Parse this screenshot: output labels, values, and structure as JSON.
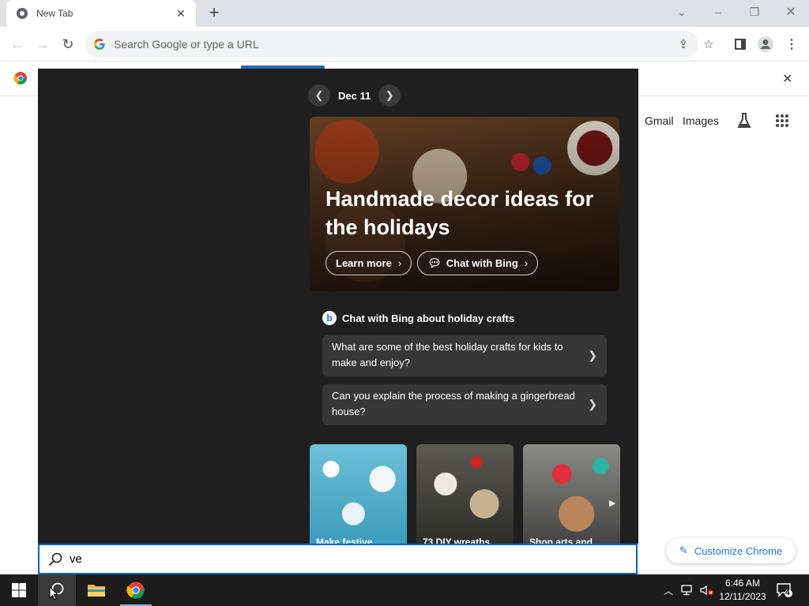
{
  "browser": {
    "tab_title": "New Tab",
    "new_tab_symbol": "+",
    "omnibox_placeholder": "Search Google or type a URL"
  },
  "ntp": {
    "gmail": "Gmail",
    "images": "Images",
    "customize": "Customize Chrome"
  },
  "search_panel": {
    "date": "Dec 11",
    "hero": {
      "title": "Handmade decor ideas for the holidays",
      "learn_more": "Learn more",
      "chat_with_bing": "Chat with Bing"
    },
    "bing_heading": "Chat with Bing about holiday crafts",
    "questions": [
      "What are some of the best holiday crafts for kids to make and enjoy?",
      "Can you explain the process of making a gingerbread house?"
    ],
    "cards": [
      "Make festive",
      "73 DIY wreaths",
      "Shop arts and"
    ],
    "query": "ve"
  },
  "taskbar": {
    "time": "6:46 AM",
    "date": "12/11/2023",
    "notifications": "4"
  },
  "colors": {
    "accent_blue": "#1a73e8",
    "search_border": "#0a64c4",
    "panel_bg": "#1f1f1f"
  }
}
